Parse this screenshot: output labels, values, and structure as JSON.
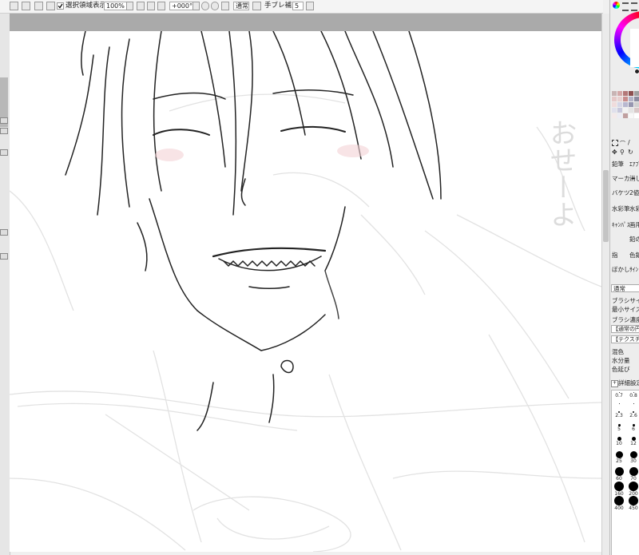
{
  "toolbar": {
    "selection_checkbox_label": "選択領域表示",
    "zoom_value": "100%",
    "rotate_value": "+000°",
    "blend_mode": "通常",
    "stabilizer_label": "手ブレ補正",
    "stabilizer_value": "5"
  },
  "canvas": {
    "handwriting_text": "おせーよ"
  },
  "right_panel": {
    "tools": [
      {
        "label": "鉛筆"
      },
      {
        "label": "ｴｱﾌﾞ"
      },
      {
        "label": "マーカー"
      },
      {
        "label": "消し"
      },
      {
        "label": "バケツ"
      },
      {
        "label": "2値"
      },
      {
        "label": "水彩筆"
      },
      {
        "label": "水彩"
      },
      {
        "label": "ｷｬﾝﾊﾟｽ"
      },
      {
        "label": "画用"
      },
      {
        "label": "鉛の"
      },
      {
        "label": "指"
      },
      {
        "label": "色鉛"
      },
      {
        "label": "ぼかし"
      },
      {
        "label": "ｻｲﾝ"
      }
    ],
    "blend_select": "通常",
    "brush_size_label": "ブラシサイズ",
    "min_size_label": "最小サイズ",
    "brush_density_label": "ブラシ濃度",
    "shape_select": "【通常の円形",
    "texture_select": "【テクスチャな",
    "mix_label": "混色",
    "water_label": "水分量",
    "color_extend_label": "色延び",
    "advanced_label": "詳細設定",
    "brush_sizes": [
      "0.7",
      "0.8",
      "",
      "",
      "2.3",
      "2.6",
      "5",
      "6",
      "10",
      "12",
      "25",
      "30",
      "60",
      "70",
      "160",
      "200",
      "400",
      "450"
    ]
  },
  "colors": {
    "accent_wheel": "#ff3b30",
    "canvas_bg": "#ffffff",
    "app_bg": "#f0f0f0"
  }
}
